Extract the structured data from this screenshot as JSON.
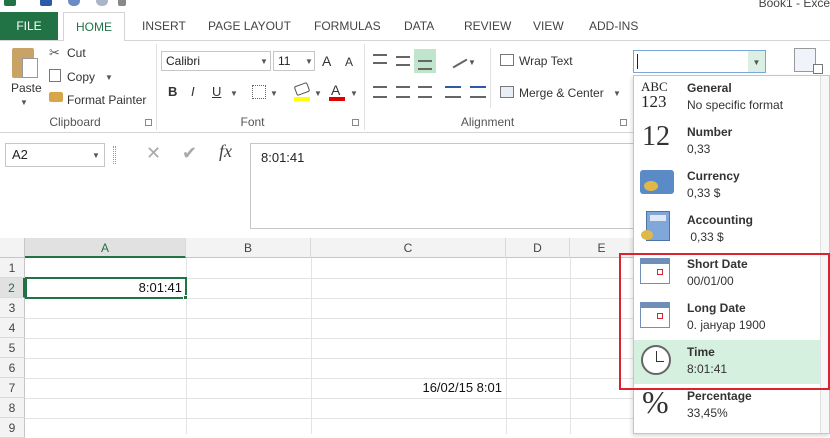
{
  "window": {
    "title": "Book1 - Exce"
  },
  "tabs": [
    "FILE",
    "HOME",
    "INSERT",
    "PAGE LAYOUT",
    "FORMULAS",
    "DATA",
    "REVIEW",
    "VIEW",
    "ADD-INS"
  ],
  "clipboard": {
    "paste": "Paste",
    "cut": "Cut",
    "copy": "Copy",
    "format_painter": "Format Painter",
    "label": "Clipboard"
  },
  "font": {
    "name": "Calibri",
    "size": "11",
    "bold": "B",
    "italic": "I",
    "underline": "U",
    "grow": "A",
    "shrink": "A",
    "label": "Font"
  },
  "alignment": {
    "wrap": "Wrap Text",
    "merge": "Merge & Center",
    "label": "Alignment"
  },
  "number_format": {
    "value": ""
  },
  "formula_bar": {
    "name_box": "A2",
    "content": "8:01:41",
    "fx": "fx"
  },
  "columns": [
    "A",
    "B",
    "C",
    "D",
    "E"
  ],
  "rows": [
    "1",
    "2",
    "3",
    "4",
    "5",
    "6",
    "7",
    "8",
    "9"
  ],
  "cells": {
    "a2": "8:01:41",
    "c7": "16/02/15 8:01"
  },
  "formats": [
    {
      "name": "General",
      "example": "No specific format",
      "icon": "abc-123-icon"
    },
    {
      "name": "Number",
      "example": "0,33",
      "icon": "number-12-icon"
    },
    {
      "name": "Currency",
      "example": "0,33 $",
      "icon": "currency-icon"
    },
    {
      "name": "Accounting",
      "example": " 0,33 $",
      "icon": "accounting-icon"
    },
    {
      "name": "Short Date",
      "example": "00/01/00",
      "icon": "calendar-icon"
    },
    {
      "name": "Long Date",
      "example": "0. јануар 1900",
      "icon": "calendar-icon"
    },
    {
      "name": "Time",
      "example": "8:01:41",
      "icon": "clock-icon"
    },
    {
      "name": "Percentage",
      "example": "33,45%",
      "icon": "percent-icon"
    }
  ],
  "icon_glyphs": {
    "general_top": "ABC",
    "general_bottom": "123",
    "number": "12",
    "percent": "%",
    "fx": "fx",
    "cancel": "✕",
    "enter": "✔"
  },
  "colors": {
    "accent": "#217346",
    "highlight": "#d5f0de",
    "annotation": "#d9232e"
  }
}
